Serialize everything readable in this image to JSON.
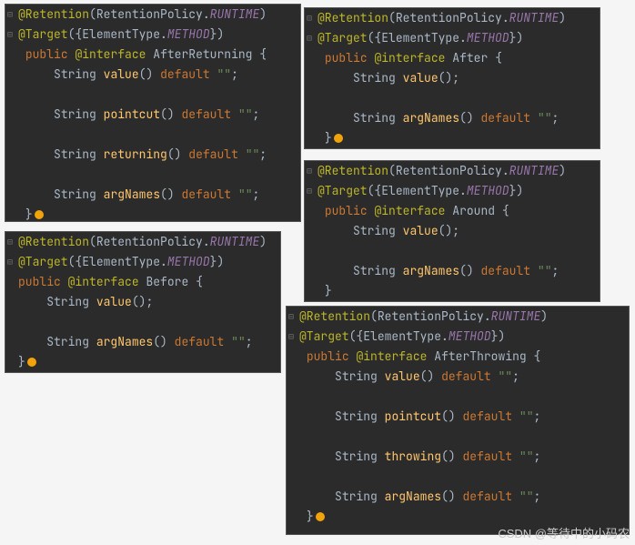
{
  "watermark": "CSDN @等待中的小码农",
  "panels": {
    "afterReturning": {
      "retention": "@Retention",
      "retentionArg1": "RetentionPolicy",
      "retentionArg2": "RUNTIME",
      "target": "@Target",
      "targetArg1": "ElementType",
      "targetArg2": "METHOD",
      "public": "public",
      "atInterface": "@interface",
      "name": "AfterReturning",
      "m1": {
        "type": "String",
        "name": "value",
        "default": "default",
        "lit": "\"\""
      },
      "m2": {
        "type": "String",
        "name": "pointcut",
        "default": "default",
        "lit": "\"\""
      },
      "m3": {
        "type": "String",
        "name": "returning",
        "default": "default",
        "lit": "\"\""
      },
      "m4": {
        "type": "String",
        "name": "argNames",
        "default": "default",
        "lit": "\"\""
      }
    },
    "before": {
      "retention": "@Retention",
      "retentionArg1": "RetentionPolicy",
      "retentionArg2": "RUNTIME",
      "target": "@Target",
      "targetArg1": "ElementType",
      "targetArg2": "METHOD",
      "public": "public",
      "atInterface": "@interface",
      "name": "Before",
      "m1": {
        "type": "String",
        "name": "value"
      },
      "m2": {
        "type": "String",
        "name": "argNames",
        "default": "default",
        "lit": "\"\""
      }
    },
    "after": {
      "retention": "@Retention",
      "retentionArg1": "RetentionPolicy",
      "retentionArg2": "RUNTIME",
      "target": "@Target",
      "targetArg1": "ElementType",
      "targetArg2": "METHOD",
      "public": "public",
      "atInterface": "@interface",
      "name": "After",
      "m1": {
        "type": "String",
        "name": "value"
      },
      "m2": {
        "type": "String",
        "name": "argNames",
        "default": "default",
        "lit": "\"\""
      }
    },
    "around": {
      "retention": "@Retention",
      "retentionArg1": "RetentionPolicy",
      "retentionArg2": "RUNTIME",
      "target": "@Target",
      "targetArg1": "ElementType",
      "targetArg2": "METHOD",
      "public": "public",
      "atInterface": "@interface",
      "name": "Around",
      "m1": {
        "type": "String",
        "name": "value"
      },
      "m2": {
        "type": "String",
        "name": "argNames",
        "default": "default",
        "lit": "\"\""
      }
    },
    "afterThrowing": {
      "retention": "@Retention",
      "retentionArg1": "RetentionPolicy",
      "retentionArg2": "RUNTIME",
      "target": "@Target",
      "targetArg1": "ElementType",
      "targetArg2": "METHOD",
      "public": "public",
      "atInterface": "@interface",
      "name": "AfterThrowing",
      "m1": {
        "type": "String",
        "name": "value",
        "default": "default",
        "lit": "\"\""
      },
      "m2": {
        "type": "String",
        "name": "pointcut",
        "default": "default",
        "lit": "\"\""
      },
      "m3": {
        "type": "String",
        "name": "throwing",
        "default": "default",
        "lit": "\"\""
      },
      "m4": {
        "type": "String",
        "name": "argNames",
        "default": "default",
        "lit": "\"\""
      }
    }
  }
}
